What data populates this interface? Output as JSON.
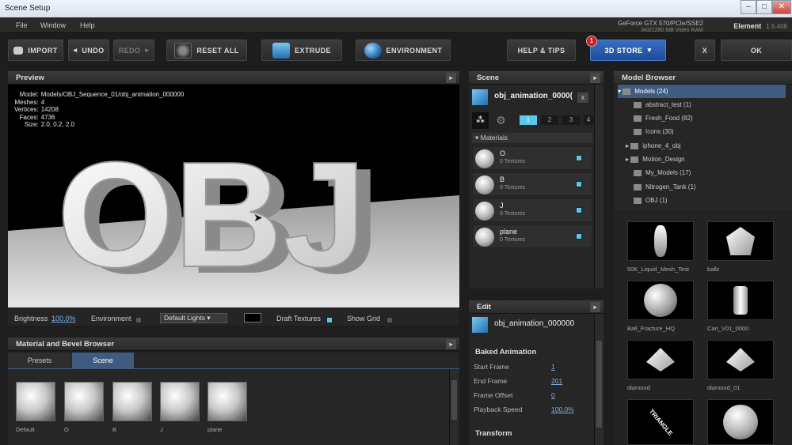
{
  "window": {
    "title": "Scene Setup",
    "buttons": [
      "–",
      "□",
      "✕"
    ]
  },
  "menu": [
    "File",
    "Window",
    "Help"
  ],
  "gpu": {
    "line1": "GeForce GTX 570/PCIe/SSE2",
    "line2": "343/1280 MB Video RAM"
  },
  "app": {
    "name": "Element",
    "version": "1.5.409"
  },
  "toolbar": {
    "import": "IMPORT",
    "undo": "UNDO",
    "redo": "REDO",
    "reset_all": "RESET ALL",
    "extrude": "EXTRUDE",
    "environment": "ENVIRONMENT",
    "help_tips": "HELP & TIPS",
    "store": "3D STORE",
    "store_badge": "1",
    "close": "X",
    "ok": "OK"
  },
  "preview": {
    "header": "Preview",
    "info_labels": [
      "Model:",
      "Meshes:",
      "Vertices:",
      "Faces:",
      "Size:"
    ],
    "info_values": [
      "Models/OBJ_Sequence_01/obj_animation_000000",
      "4",
      "14208",
      "4736",
      "2.0, 0.2, 2.0"
    ],
    "scene_text": "OBJ",
    "brightness_label": "Brightness",
    "brightness_value": "100.0%",
    "environment_label": "Environment",
    "lights_value": "Default Lights",
    "draft_label": "Draft Textures",
    "grid_label": "Show Grid"
  },
  "materials_browser": {
    "header": "Material and Bevel Browser",
    "tabs": [
      "Presets",
      "Scene"
    ],
    "presets": [
      "Default",
      "O",
      "B",
      "J",
      "plane"
    ]
  },
  "scene": {
    "header": "Scene",
    "object_name": "obj_animation_0000(",
    "close": "x",
    "frames": [
      "1",
      "2",
      "3",
      "4"
    ],
    "materials_label": "Materials",
    "materials": [
      {
        "name": "O",
        "textures": "0 Textures"
      },
      {
        "name": "B",
        "textures": "0 Textures"
      },
      {
        "name": "J",
        "textures": "0 Textures"
      },
      {
        "name": "plane",
        "textures": "0 Textures"
      }
    ]
  },
  "edit": {
    "header": "Edit",
    "object_name": "obj_animation_000000",
    "baked_label": "Baked Animation",
    "props": [
      {
        "label": "Start Frame",
        "value": "1"
      },
      {
        "label": "End Frame",
        "value": "201"
      },
      {
        "label": "Frame Offset",
        "value": "0"
      },
      {
        "label": "Playback Speed",
        "value": "100.0%"
      }
    ],
    "transform_label": "Transform"
  },
  "model_browser": {
    "header": "Model Browser",
    "tree": [
      {
        "label": "Models (24)",
        "expanded": true
      },
      {
        "label": "abstract_test (1)"
      },
      {
        "label": "Fresh_Food (82)"
      },
      {
        "label": "Icons (30)"
      },
      {
        "label": "iphone_4_obj",
        "expandable": true
      },
      {
        "label": "Motion_Design",
        "expandable": true
      },
      {
        "label": "My_Models (17)"
      },
      {
        "label": "Nitrogen_Tank (1)"
      },
      {
        "label": "OBJ (1)"
      }
    ],
    "thumbs": [
      "50K_Liquid_Mesh_Test",
      "ballz",
      "Ball_Fracture_HQ",
      "Can_V01_0000",
      "diamond",
      "diamond_01",
      "",
      ""
    ],
    "thumb_text": "TRIANGLE"
  },
  "colors": {
    "accent": "#5bc8ea",
    "store": "#2a5bb0",
    "badge": "#c81e1e",
    "selection": "#3d5c80"
  }
}
